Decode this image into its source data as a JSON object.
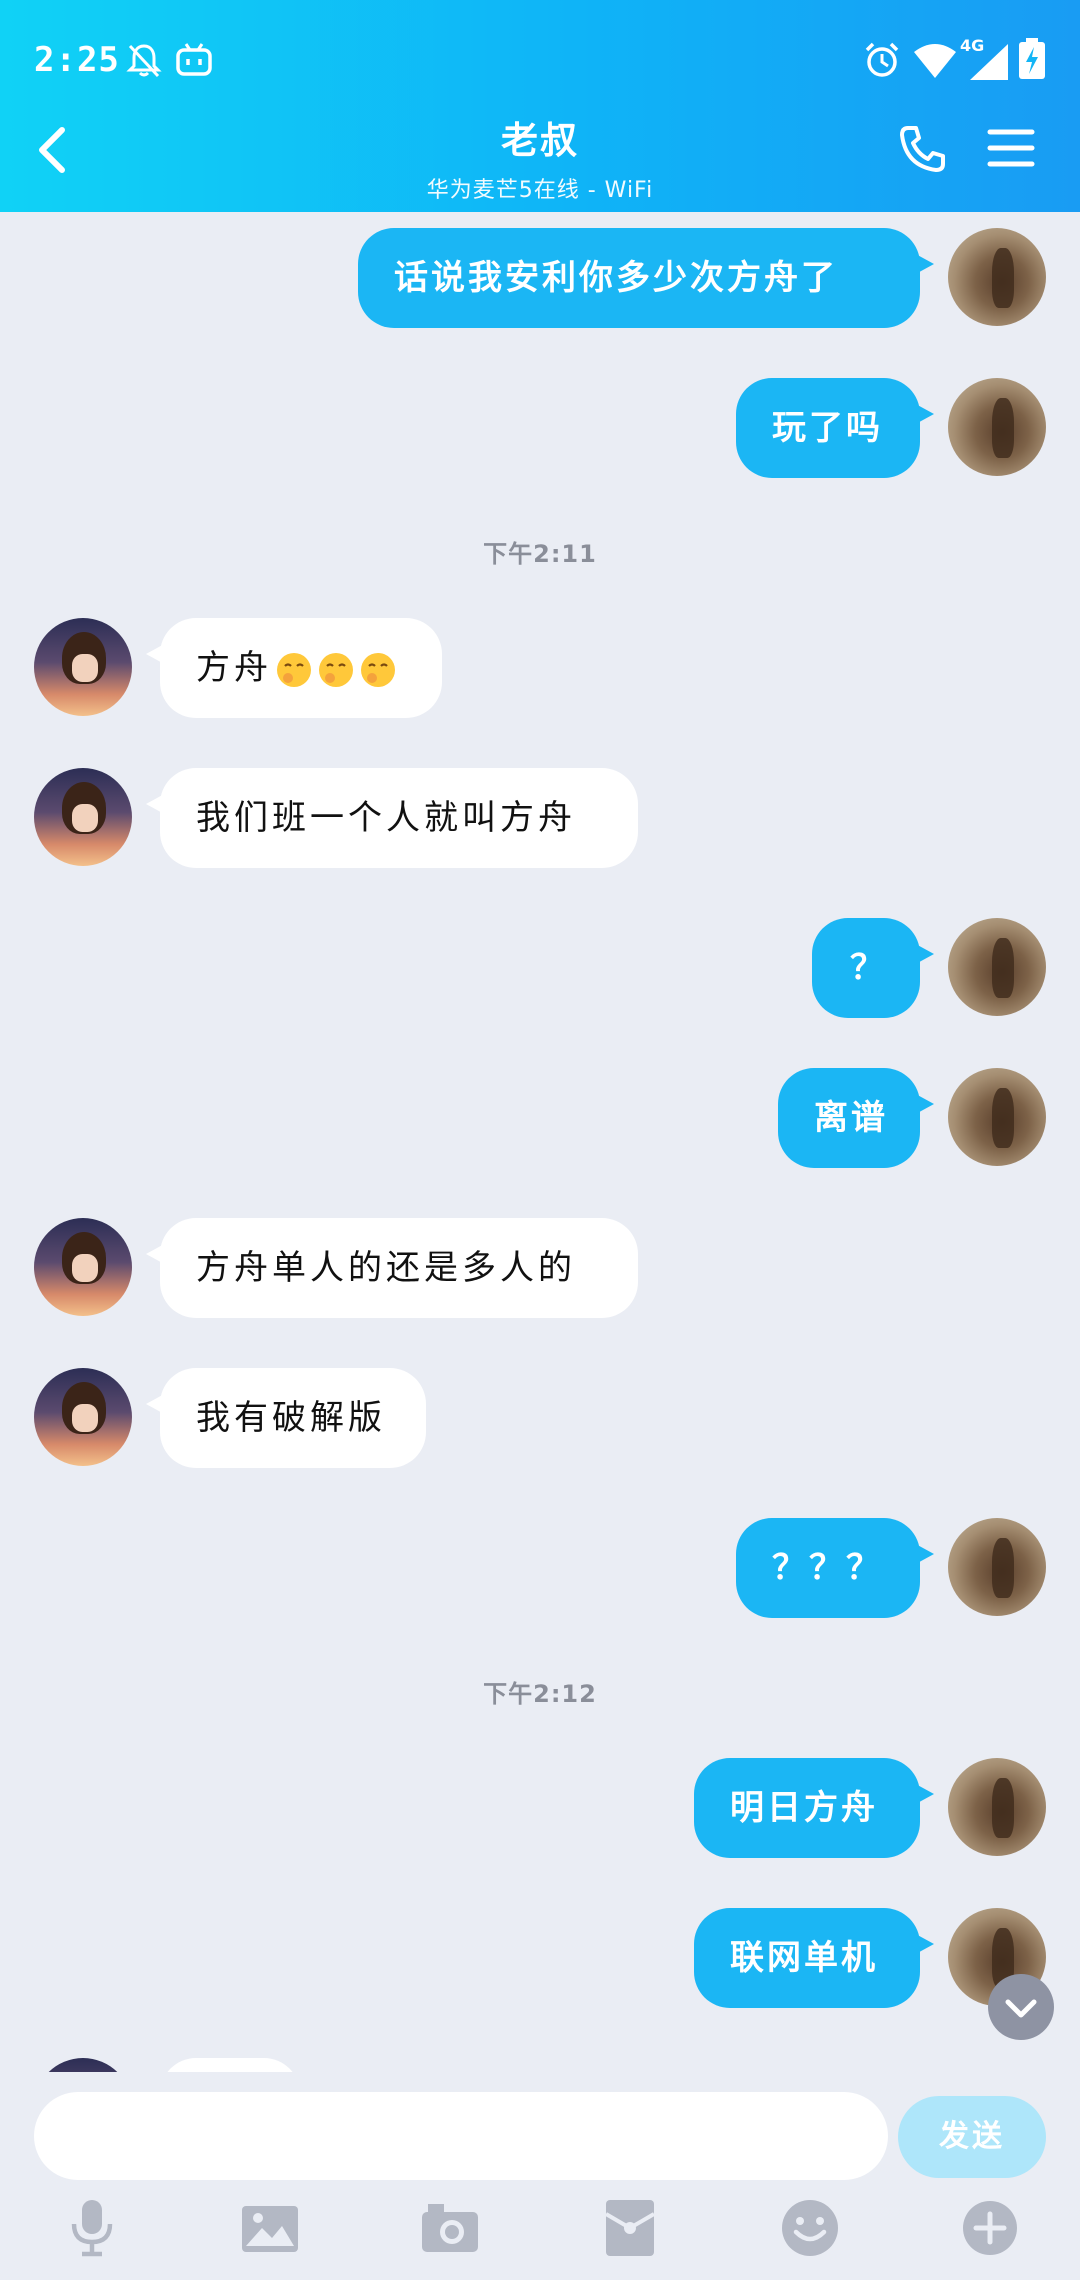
{
  "status_bar": {
    "time": "2:25",
    "network": "4G"
  },
  "header": {
    "title": "老叔",
    "subtitle": "华为麦芒5在线 - WiFi"
  },
  "colors": {
    "accent": "#1bb6f4",
    "header_start": "#10d2f6",
    "send_disabled": "#aee6fa"
  },
  "messages": [
    {
      "from": "me",
      "text": "话说我安利你多少次方舟了"
    },
    {
      "from": "me",
      "text": "玩了吗"
    },
    {
      "type": "time",
      "text": "下午2:11"
    },
    {
      "from": "peer",
      "text": "方舟",
      "emoji_count": 3
    },
    {
      "from": "peer",
      "text": "我们班一个人就叫方舟"
    },
    {
      "from": "me",
      "text": "？"
    },
    {
      "from": "me",
      "text": "离谱"
    },
    {
      "from": "peer",
      "text": "方舟单人的还是多人的"
    },
    {
      "from": "peer",
      "text": "我有破解版"
    },
    {
      "from": "me",
      "text": "？？？"
    },
    {
      "type": "time",
      "text": "下午2:12"
    },
    {
      "from": "me",
      "text": "明日方舟"
    },
    {
      "from": "me",
      "text": "联网单机"
    }
  ],
  "input": {
    "value": "",
    "send_label": "发送"
  },
  "toolbar": [
    "mic-icon",
    "image-icon",
    "camera-icon",
    "red-packet-icon",
    "emoji-icon",
    "plus-icon"
  ]
}
